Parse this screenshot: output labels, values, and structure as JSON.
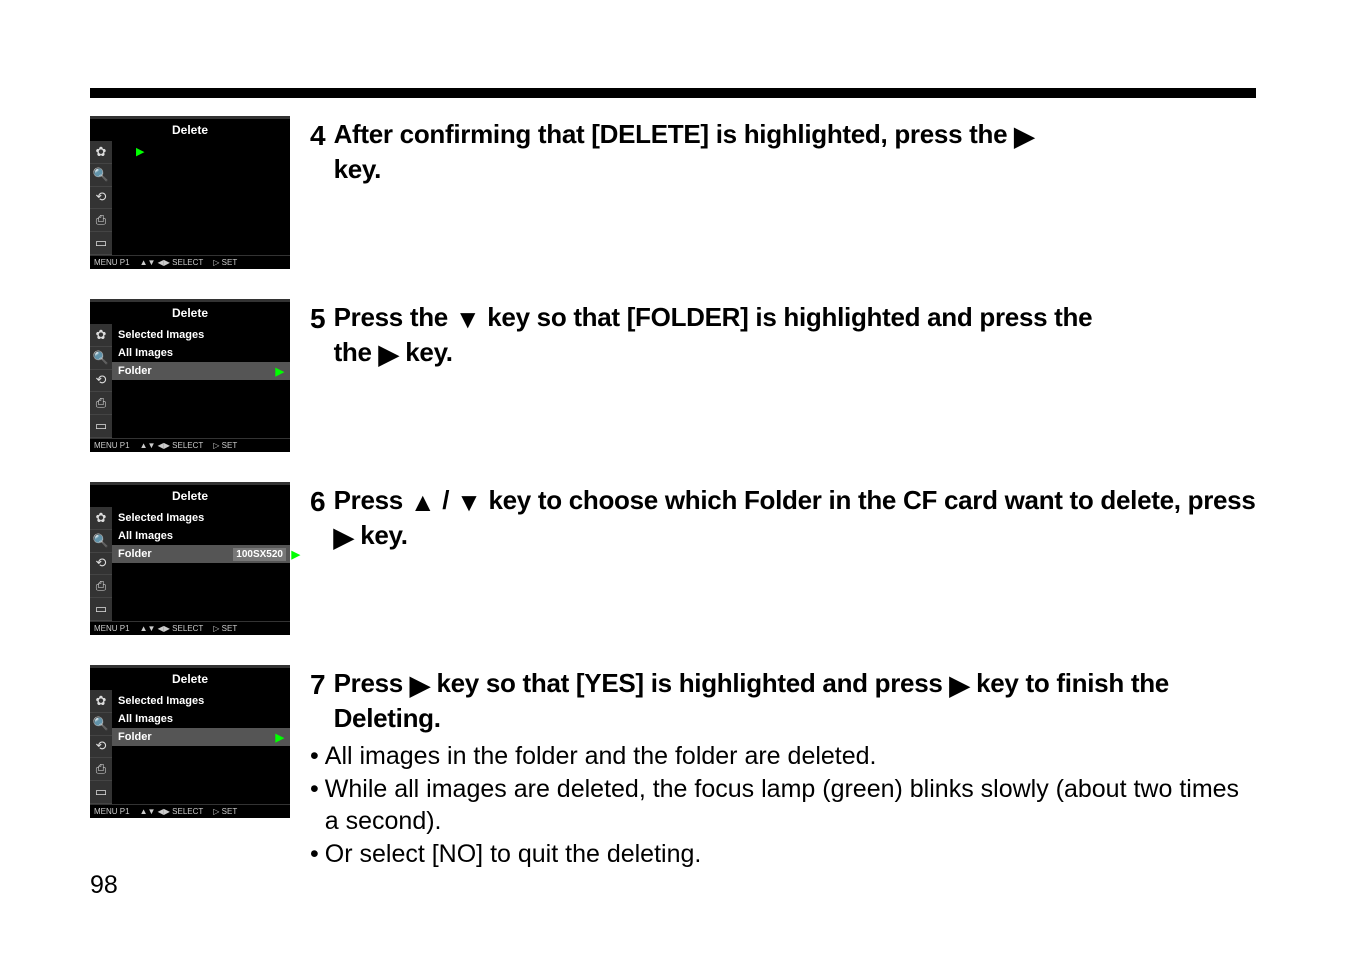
{
  "page_number": "98",
  "screens": {
    "s1": {
      "title": "Delete",
      "footer_menu": "MENU P1",
      "footer_select": "▲▼  ◀▶  SELECT",
      "footer_set": "▷ SET"
    },
    "s2": {
      "title": "Delete",
      "item1": "Selected Images",
      "item2": "All Images",
      "item3": "Folder",
      "footer_menu": "MENU P1",
      "footer_select": "▲▼  ◀▶  SELECT",
      "footer_set": "▷ SET"
    },
    "s3": {
      "title": "Delete",
      "item1": "Selected Images",
      "item2": "All Images",
      "item3": "Folder",
      "item3_value": "100SX520",
      "footer_menu": "MENU P1",
      "footer_select": "▲▼  ◀▶  SELECT",
      "footer_set": "▷ SET"
    },
    "s4": {
      "title": "Delete",
      "item1": "Selected Images",
      "item2": "All Images",
      "item3": "Folder",
      "footer_menu": "MENU P1",
      "footer_select": "▲▼  ◀▶  SELECT",
      "footer_set": "▷ SET"
    }
  },
  "steps": {
    "s4": {
      "num": "4",
      "text_a": "After confirming that [DELETE] is highlighted, press the ",
      "text_b": "key."
    },
    "s5": {
      "num": "5",
      "text_a": "Press the ",
      "text_b": " key so that [FOLDER] is highlighted and press the ",
      "text_c": " key."
    },
    "s6": {
      "num": "6",
      "text_a": "Press ",
      "text_b": " / ",
      "text_c": " key to choose which Folder in the CF card want to delete, press ",
      "text_d": " key."
    },
    "s7": {
      "num": "7",
      "text_a": "Press ",
      "text_b": " key so that [YES] is highlighted and press ",
      "text_c": " key to finish the Deleting.",
      "bullet1": "All images in the folder and the folder are deleted.",
      "bullet2": "While all images are deleted, the focus lamp (green) blinks slowly (about two times a second).",
      "bullet3": "Or select [NO] to quit the deleting."
    }
  }
}
